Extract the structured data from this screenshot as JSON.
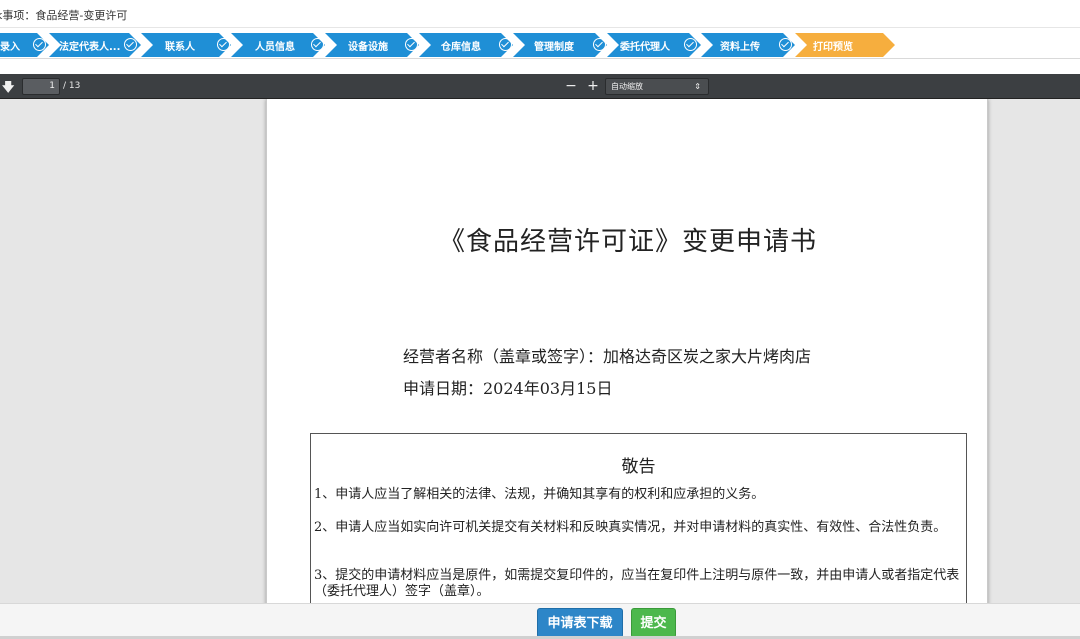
{
  "header": {
    "title": "k事项：食品经营-变更许可"
  },
  "steps": [
    {
      "label": "录入",
      "done": true
    },
    {
      "label": "法定代表人...",
      "done": true
    },
    {
      "label": "联系人",
      "done": true
    },
    {
      "label": "人员信息",
      "done": true
    },
    {
      "label": "设备设施",
      "done": true
    },
    {
      "label": "仓库信息",
      "done": true
    },
    {
      "label": "管理制度",
      "done": true
    },
    {
      "label": "委托代理人",
      "done": true
    },
    {
      "label": "资料上传",
      "done": true
    },
    {
      "label": "打印预览",
      "active": true
    }
  ],
  "colors": {
    "step_done": "#1f8fd6",
    "step_active": "#f6ae3e",
    "download_button": "#2d86c8",
    "submit_button": "#4cb84c",
    "toolbar": "#3c3f42"
  },
  "pdf_toolbar": {
    "download_icon": "download-arrow-icon",
    "current_page": "1",
    "page_count": "/ 13",
    "zoom_out": "−",
    "zoom_in": "+",
    "zoom_label": "自动缩放",
    "zoom_caret": "⇕"
  },
  "document": {
    "title": "《食品经营许可证》变更申请书",
    "operator_line": "经营者名称（盖章或签字）：加格达奇区炭之家大片烤肉店",
    "date_line": "申请日期：2024年03月15日",
    "notice": {
      "title": "敬告",
      "items": [
        "1、申请人应当了解相关的法律、法规，并确知其享有的权利和应承担的义务。",
        "2、申请人应当如实向许可机关提交有关材料和反映真实情况，并对申请材料的真实性、有效性、合法性负责。",
        "3、提交的申请材料应当是原件，如需提交复印件的，应当在复印件上注明与原件一致，并由申请人或者指定代表（委托代理人）签字（盖章）。"
      ]
    }
  },
  "footer": {
    "download_label": "申请表下载",
    "submit_label": "提交"
  }
}
